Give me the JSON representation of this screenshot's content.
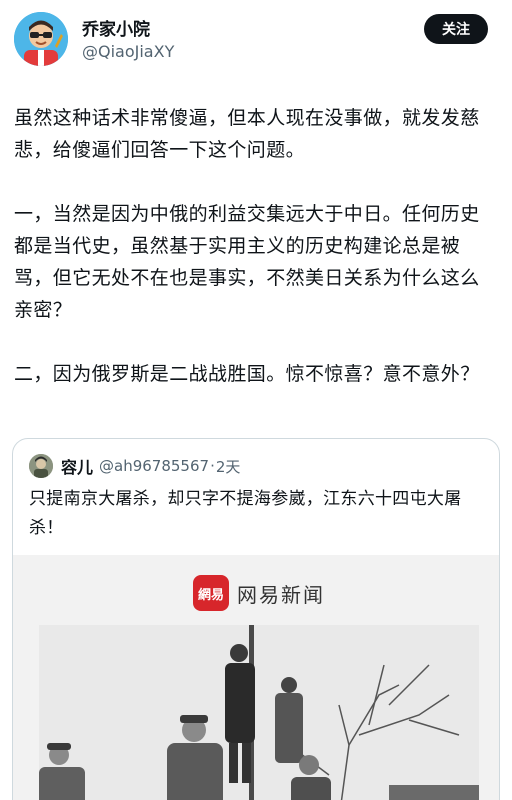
{
  "author": {
    "name": "乔家小院",
    "handle": "@QiaoJiaXY",
    "follow_label": "关注"
  },
  "tweet": {
    "paragraphs": [
      "虽然这种话术非常傻逼，但本人现在没事做，就发发慈悲，给傻逼们回答一下这个问题。",
      "一，当然是因为中俄的利益交集远大于中日。任何历史都是当代史，虽然基于实用主义的历史构建论总是被骂，但它无处不在也是事实，不然美日关系为什么这么亲密？",
      "二，因为俄罗斯是二战战胜国。惊不惊喜？意不意外？"
    ]
  },
  "quote": {
    "name": "容儿",
    "handle": "@ah96785567",
    "dot": "·",
    "time": "2天",
    "text": "只提南京大屠杀，却只字不提海参崴，江东六十四屯大屠杀！",
    "image": {
      "logo_mark": "網易",
      "logo_text": "网易新闻"
    }
  },
  "colors": {
    "text": "#0f1419",
    "muted": "#536471",
    "border": "#cfd9de",
    "follow_bg": "#0f1419",
    "logo_red": "#d7262b"
  },
  "icons": {
    "author_avatar": "cartoon-avatar-icon",
    "quote_avatar": "photo-avatar-icon"
  }
}
